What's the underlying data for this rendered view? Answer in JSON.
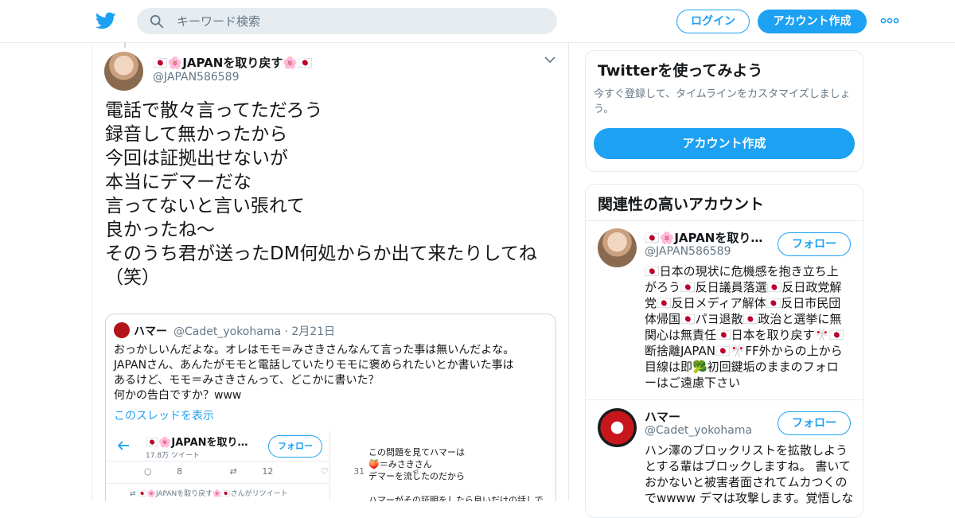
{
  "header": {
    "search_placeholder": "キーワード検索",
    "login_label": "ログイン",
    "signup_label": "アカウント作成",
    "brand_color": "#1da1f2"
  },
  "tweet": {
    "display_name": "🇯🇵🌸JAPANを取り戻す🌸🇯🇵",
    "handle": "@JAPAN586589",
    "text_lines": [
      "電話で散々言ってただろう",
      "録音して無かったから",
      "今回は証拠出せないが",
      "本当にデマーだな",
      "言ってないと言い張れて",
      "良かったね～",
      "そのうち君が送ったDM何処からか出て来たりしてね",
      "（笑）"
    ],
    "quote": {
      "name": "ハマー",
      "handle": "@Cadet_yokohama",
      "date": "· 2月21日",
      "text_lines": [
        "おっかしいんだよな。オレはモモ＝みさきさんなんて言った事は無いんだよな。",
        "JAPANさん、あんたがモモと電話していたりモモに褒められたいとか書いた事は",
        "あるけど、モモ＝みさきさんって、どこかに書いた？",
        "何かの告白ですか？www"
      ],
      "thread_link": "このスレッドを表示",
      "image": {
        "name": "🇯🇵🌸JAPANを取り…",
        "tweets_count": "17.8万 ツイート",
        "follow_label": "フォロー",
        "replies": "8",
        "retweets": "12",
        "likes": "31",
        "retweet_note": "🇯🇵🌸JAPANを取り戻す🌸🇯🇵さんがリツイート",
        "right_lines": [
          "この問題を見てハマーは",
          "🍑＝みさきさん",
          "デマーを流したのだから",
          "",
          "ハマーがその証明をしたら良いだけの話しで"
        ]
      }
    }
  },
  "signup_card": {
    "title": "Twitterを使ってみよう",
    "description": "今すぐ登録して、タイムラインをカスタマイズしましょう。",
    "button_label": "アカウント作成"
  },
  "related": {
    "title": "関連性の高いアカウント",
    "accounts": [
      {
        "name": "🇯🇵🌸JAPANを取り…",
        "handle": "@JAPAN586589",
        "follow_label": "フォロー",
        "bio_lines": [
          "🇯🇵日本の現状に危機感を抱き立ち上",
          "がろう🇯🇵反日議員落選🇯🇵反日政党解",
          "党🇯🇵反日メディア解体🇯🇵反日市民団",
          "体帰国🇯🇵パヨ退散🇯🇵政治と選挙に無",
          "関心は無責任🇯🇵日本を取り戻す🎌🇯🇵",
          "断捨離JAPAN🇯🇵🎌FF外からの上から",
          "目線は即🥦初回鍵垢のままのフォロ",
          "ーはご遠慮下さい"
        ]
      },
      {
        "name": "ハマー",
        "handle": "@Cadet_yokohama",
        "follow_label": "フォロー",
        "bio_lines": [
          "ハン澤のブロックリストを拡散しよう",
          "とする輩はブロックしますね。 書いて",
          "おかないと被害者面されてムカつくの",
          "でwwww デマは攻撃します。覚悟しな"
        ]
      }
    ]
  }
}
